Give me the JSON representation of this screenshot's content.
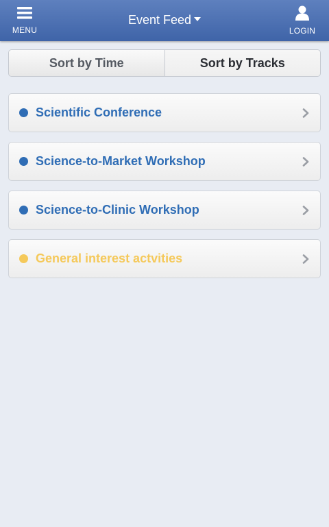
{
  "header": {
    "menu_label": "MENU",
    "menu_icon": "hamburger-icon",
    "title": "Event Feed",
    "title_icon": "caret-down-icon",
    "login_label": "LOGIN",
    "login_icon": "user-icon",
    "bar_color": "#4a6fb3"
  },
  "sort": {
    "time_label": "Sort by Time",
    "tracks_label": "Sort by Tracks",
    "selected": "Sort by Tracks"
  },
  "tracks": [
    {
      "label": "Scientific Conference",
      "color": "#2f6db5"
    },
    {
      "label": "Science-to-Market Workshop",
      "color": "#2f6db5"
    },
    {
      "label": "Science-to-Clinic Workshop",
      "color": "#2f6db5"
    },
    {
      "label": "General interest actvities",
      "color": "#f5c95a"
    }
  ],
  "chevron_icon": "chevron-right-icon"
}
